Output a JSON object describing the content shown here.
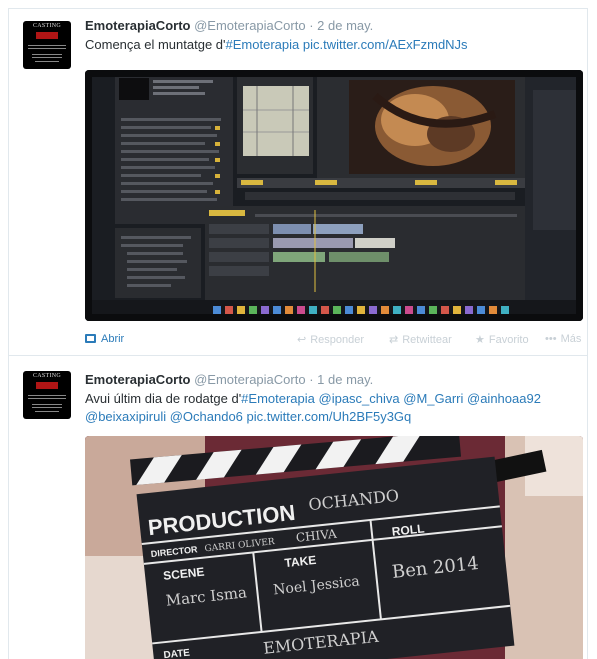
{
  "tweets": [
    {
      "avatar_text": "CASTING",
      "name": "EmoterapiaCorto",
      "handle": "@EmoterapiaCorto",
      "separator": "·",
      "date": "2 de may.",
      "text_plain": "Comença el muntatge d'",
      "link_hashtag": "#Emoterapia",
      "link_pic": "pic.twitter.com/AExFzmdNJs",
      "open_label": "Abrir",
      "reply_label": "Responder",
      "retweet_label": "Retwittear",
      "favorite_label": "Favorito",
      "more_label": "Más"
    },
    {
      "avatar_text": "CASTING",
      "name": "EmoterapiaCorto",
      "handle": "@EmoterapiaCorto",
      "separator": "·",
      "date": "1 de may.",
      "text_plain": "Avui últim dia de rodatge d'",
      "link_hashtag": "#Emoterapia",
      "mentions_line1": "@ipasc_chiva @M_Garri @ainhoaa92",
      "mentions_line2": "@beixaxipiruli @Ochando6",
      "link_pic": "pic.twitter.com/Uh2BF5y3Gq",
      "clapper": {
        "production": "PRODUCTION",
        "production_value": "OCHANDO",
        "director": "DIRECTOR",
        "director_value": "CHIVA",
        "camera_value": "GARRI OLIVER",
        "scene": "SCENE",
        "scene_value": "Marc Isma",
        "take": "TAKE",
        "take_value": "Noel Jessica",
        "roll": "ROLL",
        "roll_value": "Ben 2014",
        "date": "DATE",
        "bottom_value": "EMOTERAPIA"
      }
    }
  ],
  "icons": {
    "reply": "↩",
    "retweet": "⇄",
    "favorite": "★",
    "more": "•••"
  },
  "colors": {
    "link": "#2b7bb9",
    "name": "#292f33",
    "meta": "#8899a6"
  }
}
